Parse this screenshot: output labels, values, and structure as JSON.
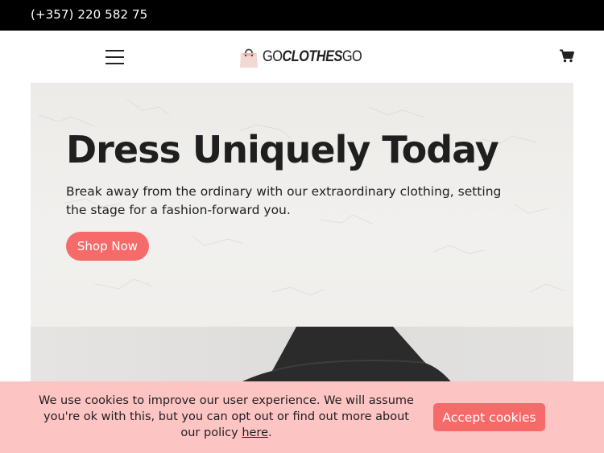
{
  "topbar": {
    "phone": "(+357) 220 582 75"
  },
  "header": {
    "menu_icon": "hamburger-menu-icon",
    "logo_parts": [
      "GO",
      "CLOTHES",
      "GO"
    ],
    "cart_icon": "shopping-cart-icon"
  },
  "hero": {
    "title": "Dress Uniquely Today",
    "subtitle": "Break away from the ordinary with our extraordinary clothing, setting the stage for a fashion-forward you.",
    "cta_label": "Shop Now"
  },
  "cookie_banner": {
    "message": "We use cookies to improve our user experience. We will assume you're ok with this, but you can opt out or find out more about our policy ",
    "link_label": "here",
    "trailing": ".",
    "accept_label": "Accept cookies"
  },
  "colors": {
    "topbar_bg": "#000000",
    "accent": "#f76a6a",
    "cookie_bg": "#fdc4c4"
  }
}
